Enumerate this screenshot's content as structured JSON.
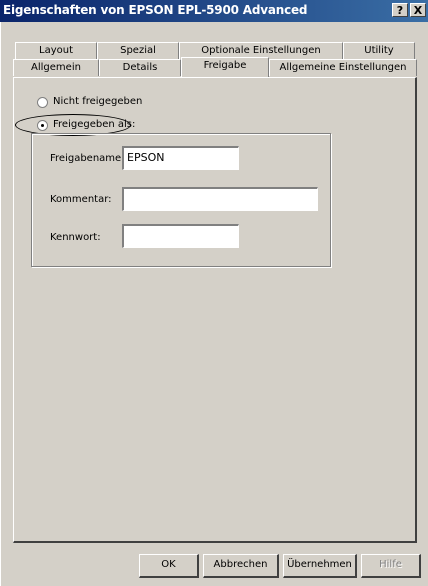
{
  "window": {
    "title": "Eigenschaften von EPSON EPL-5900 Advanced",
    "help_glyph": "?",
    "close_glyph": "X"
  },
  "tabs_row1": [
    {
      "label": "Layout"
    },
    {
      "label": "Spezial"
    },
    {
      "label": "Optionale Einstellungen"
    },
    {
      "label": "Utility"
    }
  ],
  "tabs_row2": [
    {
      "label": "Allgemein"
    },
    {
      "label": "Details"
    },
    {
      "label": "Freigabe",
      "active": true
    },
    {
      "label": "Allgemeine Einstellungen"
    }
  ],
  "sharing": {
    "not_shared_label": "Nicht freigegeben",
    "shared_as_label": "Freigegeben als:",
    "selected": "shared_as",
    "share_name_label": "Freigabename:",
    "share_name_value": "EPSON",
    "comment_label": "Kommentar:",
    "comment_value": "",
    "password_label": "Kennwort:",
    "password_value": ""
  },
  "buttons": {
    "ok": "OK",
    "cancel": "Abbrechen",
    "apply": "Übernehmen",
    "help": "Hilfe"
  }
}
